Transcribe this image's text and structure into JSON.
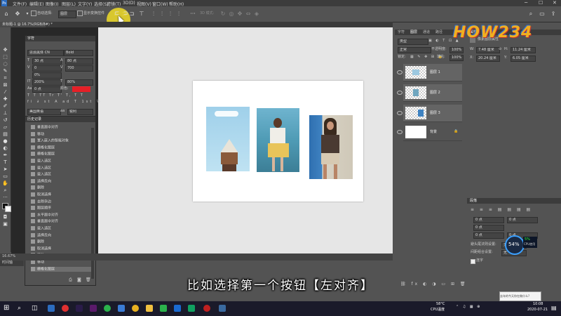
{
  "menu": [
    "文件(F)",
    "编辑(E)",
    "图像(I)",
    "图层(L)",
    "文字(Y)",
    "选择(S)",
    "滤镜(T)",
    "3D(D)",
    "视图(V)",
    "窗口(W)",
    "帮助(H)"
  ],
  "options": {
    "auto_select_label": "自动选择:",
    "auto_select_value": "图层",
    "show_transform_label": "显示变换控件",
    "mode_3d_label": "3D 模式:"
  },
  "document_tab": "未标题-1 @ 16.7%(RGB/8#) *",
  "character_panel": {
    "tab_label": "字符",
    "font_family": "思源黑体 CN",
    "font_style": "Bold",
    "font_size": "30 点",
    "leading": "80 点",
    "kerning": "0",
    "tracking": "700",
    "scale_vertical": "200%",
    "scale_horizontal": "80%",
    "baseline": "0 点",
    "color_label": "颜色:",
    "color": "#e52027",
    "language": "美国英语",
    "aa": "锐利",
    "aa_prefix": "aa"
  },
  "history_panel": {
    "tab_label": "历史记录",
    "items": [
      "垂直居中对齐",
      "移动",
      "置入嵌入的智能对象",
      "栅格化图层",
      "栅格化图层",
      "载入选区",
      "载入选区",
      "载入选区",
      "选择反向",
      "删除",
      "取消选择",
      "去除杂边",
      "图层顺序",
      "水平居中对齐",
      "垂直居中对齐",
      "载入选区",
      "选择反向",
      "删除",
      "取消选择",
      "移动",
      "移动",
      "栅格化图层"
    ]
  },
  "right_panel": {
    "left_tabs": [
      "字符",
      "图层",
      "通道",
      "路径"
    ],
    "props_tab": "属性",
    "props_title": "像素图层属性",
    "w_label": "W:",
    "w_value": "7.48 厘米",
    "h_label": "H:",
    "h_value": "11.24 厘米",
    "x_label": "X:",
    "x_value": "20.24 厘米",
    "y_label": "Y:",
    "y_value": "6.05 厘米",
    "blend_mode": "正常",
    "opacity_label": "不透明度:",
    "opacity_value": "100%",
    "lock_label": "锁定:",
    "fill_label": "填充:",
    "fill_value": "100%",
    "kind_label": "类型",
    "layers": [
      "图层 1",
      "图层 2",
      "图层 3",
      "背景"
    ],
    "para_tab": "段落",
    "para_hyphen_label": "避头尾法则设置:",
    "para_hyphen_value": "无",
    "para_space_label": "间距组合设置:",
    "para_space_value": "无",
    "para_hyph_check": "连字",
    "indent_values": [
      "0 点",
      "0 点",
      "0 点",
      "0 点",
      "0 点"
    ]
  },
  "status": {
    "zoom": "16.67%",
    "timeline_label": "时间轴"
  },
  "cpu_widget": {
    "percent": "54%",
    "small_percent": "5%",
    "label": "CPU使用"
  },
  "watermark": "HOW234",
  "subtitle": "比如选择第一个按钮【左对齐】",
  "taskbar": {
    "temp": "58°C",
    "temp_label": "CPU温度",
    "time": "10:08",
    "date": "2020-07-21",
    "notice": "去年的今天你在做什么?"
  }
}
